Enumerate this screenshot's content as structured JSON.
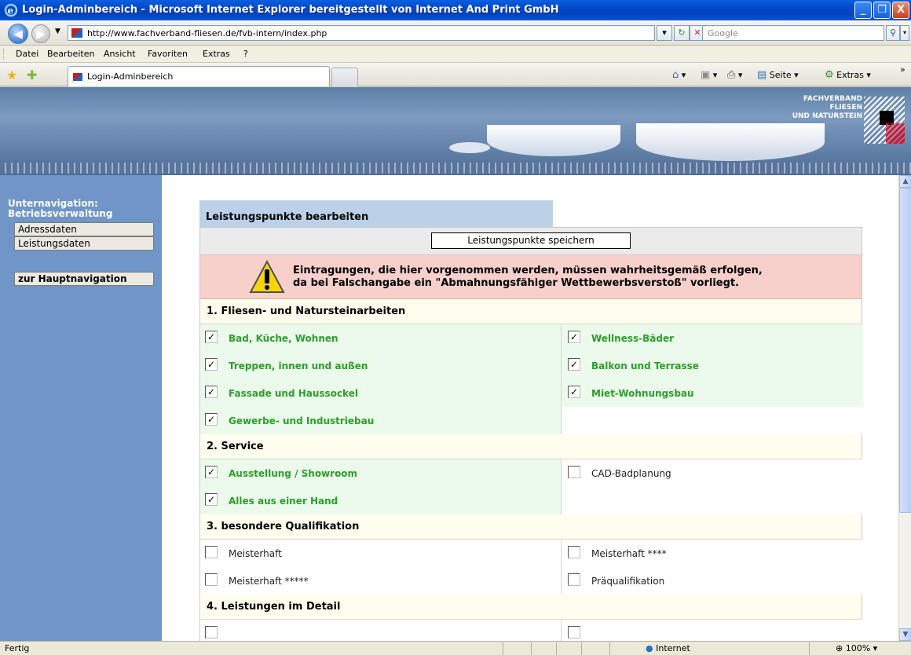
{
  "window": {
    "title": "Login-Adminbereich - Microsoft Internet Explorer bereitgestellt von Internet And Print GmbH",
    "buttons": [
      "_",
      "❐",
      "X"
    ]
  },
  "address": {
    "url": "http://www.fachverband-fliesen.de/fvb-intern/index.php",
    "search_placeholder": "Google"
  },
  "menu": [
    "Datei",
    "Bearbeiten",
    "Ansicht",
    "Favoriten",
    "Extras",
    "?"
  ],
  "tabs": {
    "active_label": "Login-Adminbereich",
    "commands": [
      "Seite ▾",
      "Extras ▾"
    ]
  },
  "banner": {
    "brand_lines": [
      "FACHVERBAND",
      "FLIESEN",
      "UND NATURSTEIN"
    ]
  },
  "sidebar": {
    "title_line1": "Unternavigation:",
    "title_line2": "Betriebsverwaltung",
    "items": [
      "Adressdaten",
      "Leistungsdaten"
    ],
    "main_nav": "zur Hauptnavigation"
  },
  "content": {
    "heading": "Leistungspunkte bearbeiten",
    "save_label": "Leistungspunkte speichern",
    "warning_line1": "Eintragungen, die hier vorgenommen werden, müssen wahrheitsgemäß erfolgen,",
    "warning_line2": "da bei Falschangabe ein \"Abmahnungsfähiger Wettbewerbsverstoß\" vorliegt.",
    "sections": [
      {
        "title": "1. Fliesen- und Natursteinarbeiten",
        "rows": [
          [
            {
              "label": "Bad, Küche, Wohnen",
              "checked": true
            },
            {
              "label": "Wellness-Bäder",
              "checked": true
            }
          ],
          [
            {
              "label": "Treppen, innen und außen",
              "checked": true
            },
            {
              "label": "Balkon und Terrasse",
              "checked": true
            }
          ],
          [
            {
              "label": "Fassade und Haussockel",
              "checked": true
            },
            {
              "label": "Miet-Wohnungsbau",
              "checked": true
            }
          ],
          [
            {
              "label": "Gewerbe- und Industriebau",
              "checked": true
            },
            null
          ]
        ]
      },
      {
        "title": "2. Service",
        "rows": [
          [
            {
              "label": "Ausstellung / Showroom",
              "checked": true
            },
            {
              "label": "CAD-Badplanung",
              "checked": false
            }
          ],
          [
            {
              "label": "Alles aus einer Hand",
              "checked": true
            },
            null
          ]
        ]
      },
      {
        "title": "3. besondere Qualifikation",
        "rows": [
          [
            {
              "label": "Meisterhaft",
              "checked": false
            },
            {
              "label": "Meisterhaft ****",
              "checked": false
            }
          ],
          [
            {
              "label": "Meisterhaft *****",
              "checked": false
            },
            {
              "label": "Präqualifikation",
              "checked": false
            }
          ]
        ]
      },
      {
        "title": "4. Leistungen im Detail",
        "rows": [
          [
            {
              "label": "",
              "checked": false
            },
            {
              "label": "",
              "checked": false
            }
          ]
        ]
      }
    ]
  },
  "status": {
    "left": "Fertig",
    "zone": "Internet",
    "zoom": "100%"
  },
  "colors": {
    "accent_blue": "#0148c8",
    "sidebar": "#6f96c6",
    "checked_label": "#2aa02a",
    "warning_bg": "#f7d0cc"
  }
}
